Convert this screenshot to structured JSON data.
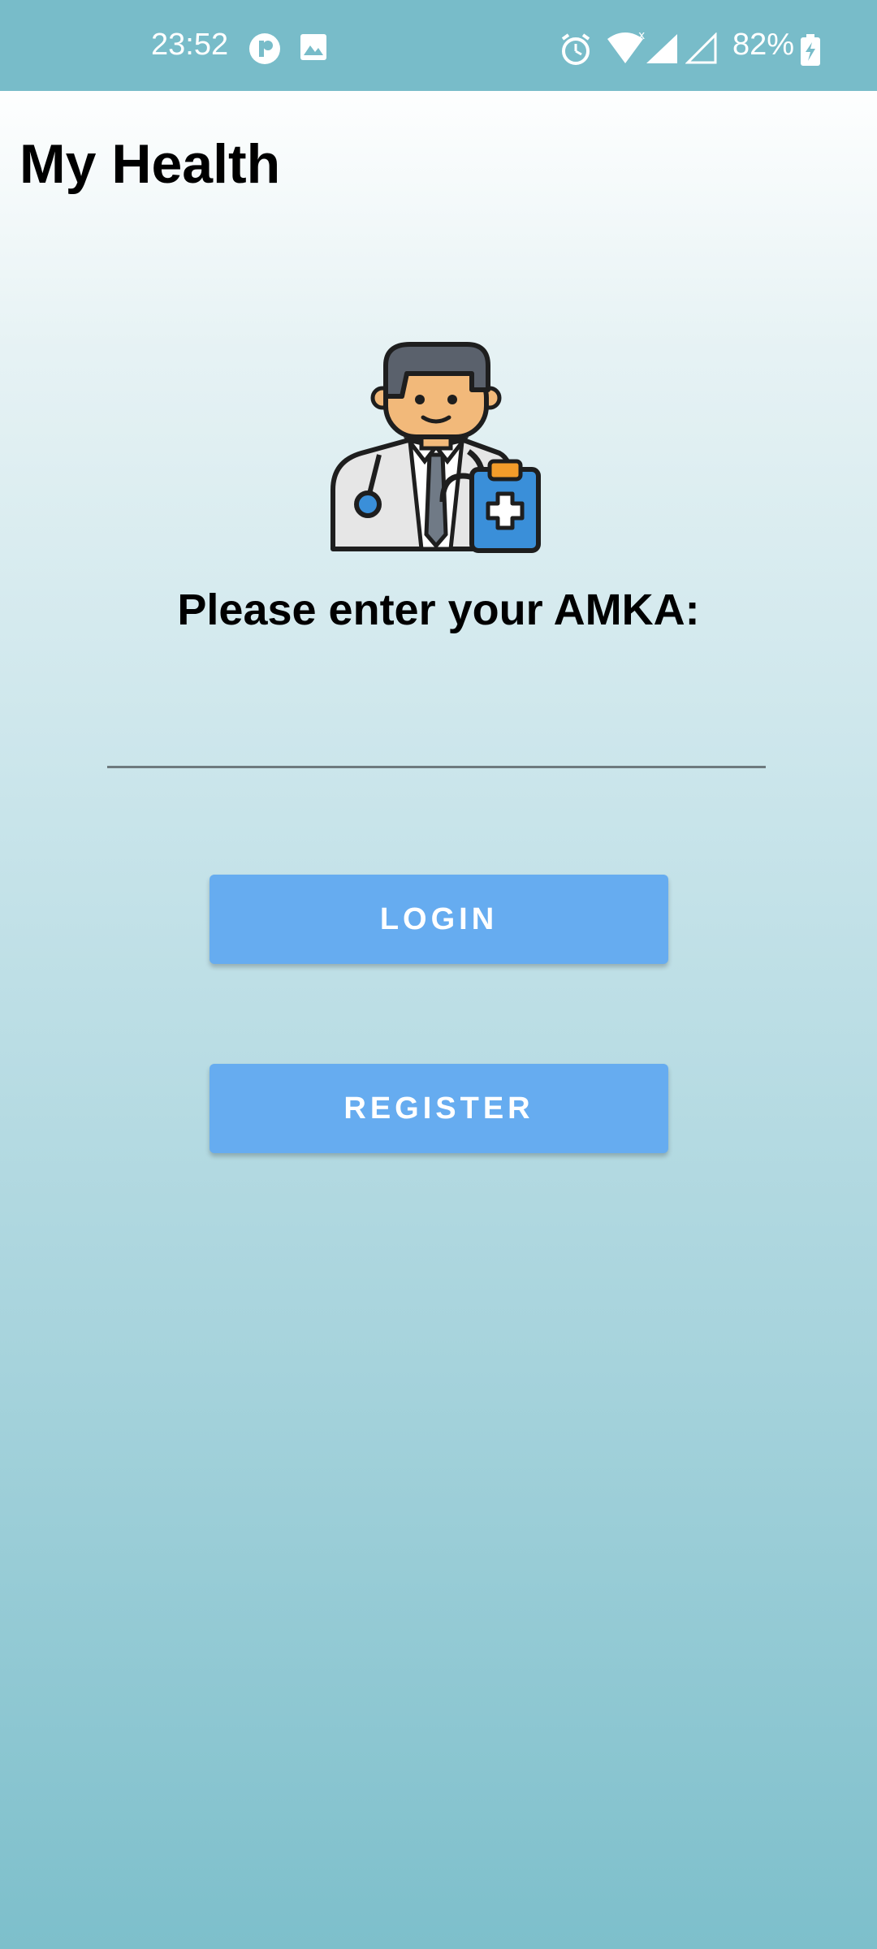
{
  "status_bar": {
    "time": "23:52",
    "battery": "82%",
    "icons": [
      "app-notification-icon",
      "image-icon",
      "alarm-icon",
      "wifi-icon",
      "signal-icon",
      "signal-empty-icon",
      "battery-charging-icon"
    ]
  },
  "app": {
    "title": "My Health"
  },
  "login": {
    "prompt": "Please enter your AMKA:",
    "amka_value": "",
    "amka_placeholder": "",
    "login_label": "LOGIN",
    "register_label": "REGISTER"
  },
  "colors": {
    "status_bar": "#78bcc9",
    "button": "#66acf0",
    "gradient_top": "#ffffff",
    "gradient_bottom": "#7dbfcb"
  }
}
